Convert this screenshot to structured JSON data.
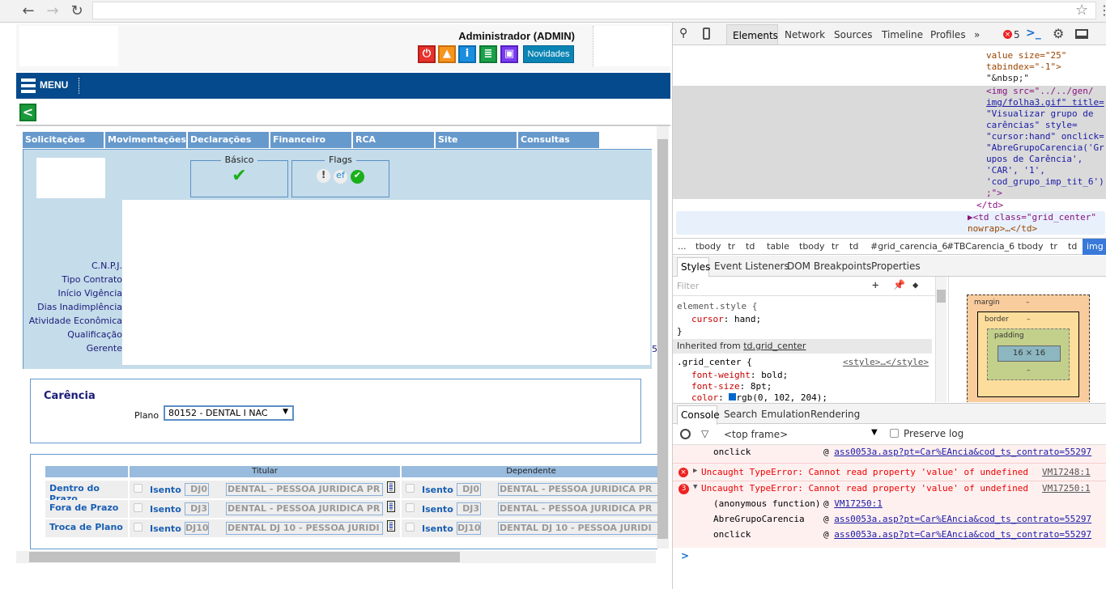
{
  "browser": {
    "back": "←",
    "forward": "→",
    "reload": "↻",
    "star": "☆",
    "menu": "⋮"
  },
  "header": {
    "user": "Administrador (ADMIN)",
    "buttons": [
      {
        "icon": "power-icon",
        "glyph": "⏻",
        "color": "#e8322d"
      },
      {
        "icon": "lock-icon",
        "glyph": "🔒",
        "color": "#f7941d"
      },
      {
        "icon": "info-icon",
        "glyph": "i",
        "color": "#1b8ee0"
      },
      {
        "icon": "list-icon",
        "glyph": "≣",
        "color": "#1aa04a"
      },
      {
        "icon": "print-icon",
        "glyph": "▣",
        "color": "#7a3cf0"
      }
    ],
    "news": "Novidades"
  },
  "menu": {
    "label": "MENU",
    "back": "<"
  },
  "tabs": [
    "Solicitações",
    "Movimentações",
    "Declarações",
    "Financeiro",
    "RCA",
    "Site",
    "Consultas"
  ],
  "panel": {
    "basico": "Básico",
    "basico_icon": "✔",
    "flags": "Flags",
    "flag_icons": [
      "!",
      "ef",
      "✔"
    ],
    "labels": [
      "C.N.P.J.",
      "Tipo Contrato",
      "Início Vigência",
      "Dias Inadimplência",
      "Atividade Econômica",
      "Qualificação",
      "Gerente"
    ],
    "side": "5"
  },
  "carencia": {
    "title": "Carência",
    "plano_label": "Plano",
    "plano_value": "80152 - DENTAL I NAC"
  },
  "grid": {
    "headers": [
      "Titular",
      "Dependente"
    ],
    "isento": "Isento",
    "rows": [
      {
        "label": "Dentro do Prazo",
        "code": "DJ0",
        "desc": "DENTAL - PESSOA JURIDICA PR"
      },
      {
        "label": "Fora de Prazo",
        "code": "DJ3",
        "desc": "DENTAL - PESSOA JURIDICA PR"
      },
      {
        "label": "Troca de Plano",
        "code": "DJ10",
        "desc": "DENTAL DJ 10 - PESSOA JURIDI"
      }
    ]
  },
  "devtools": {
    "tabs": [
      "Elements",
      "Network",
      "Sources",
      "Timeline",
      "Profiles",
      "»"
    ],
    "errors": "5",
    "code": [
      "value size=\"25\"",
      "tabindex=\"-1\">",
      "\"&nbsp;\"",
      "<img src=\"../../gen/",
      "img/folha3.gif\" title=",
      "\"Visualizar grupo de",
      "carências\" style=",
      "\"cursor:hand\" onclick=",
      "\"AbreGrupoCarencia('Gr",
      "upos de Carência',",
      "'CAR', '1',",
      "'cod_grupo_imp_tit_6')",
      ";\">"
    ],
    "td_close": "</td>",
    "td_collapsed_1": "<td class=\"grid_center\"",
    "td_collapsed_2": "nowrap>…</td>",
    "breadcrumbs": [
      "...",
      "tbody",
      "tr",
      "td",
      "table",
      "tbody",
      "tr",
      "td",
      "#grid_carencia_6",
      "#TBCarencia_6",
      "tbody",
      "tr",
      "td",
      "img"
    ],
    "style_tabs": [
      "Styles",
      "Event Listeners",
      "DOM Breakpoints",
      "Properties"
    ],
    "filter": "Filter",
    "element_style": "element.style {",
    "cursor_prop": "cursor",
    "cursor_val": "hand;",
    "close": "}",
    "inherited": "Inherited from ",
    "inherited_link": "td.grid_center",
    "rule": ".grid_center {",
    "rule_src": "<style>…</style>",
    "props": [
      {
        "k": "font-weight",
        "v": "bold;"
      },
      {
        "k": "font-size",
        "v": "8pt;"
      },
      {
        "k": "color",
        "v": "rgb(0, 102, 204);"
      }
    ],
    "boxmodel": {
      "margin": "margin",
      "border": "border",
      "padding": "padding",
      "content": "16 × 16",
      "dash": "–"
    },
    "console_tabs": [
      "Console",
      "Search",
      "Emulation",
      "Rendering"
    ],
    "frame": "<top frame>",
    "preserve": "Preserve log",
    "messages": {
      "onclick": "onclick",
      "link": "ass0053a.asp?pt=Car%EAncia&cod_ts_contrato=55297",
      "err": "Uncaught TypeError: Cannot read property 'value' of undefined",
      "src1": "VM17248:1",
      "src2": "VM17250:1",
      "count": "3",
      "anon": "(anonymous function)",
      "abre": "AbreGrupoCarencia"
    },
    "prompt": ">"
  }
}
